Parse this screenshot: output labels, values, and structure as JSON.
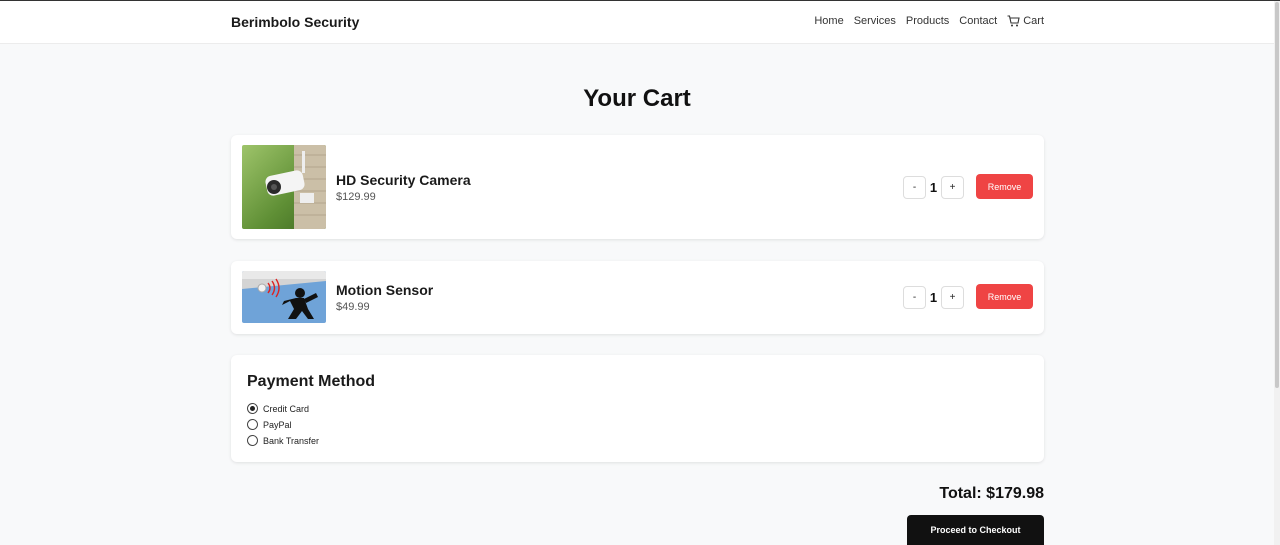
{
  "brand": "Berimbolo Security",
  "nav": {
    "home": "Home",
    "services": "Services",
    "products": "Products",
    "contact": "Contact",
    "cart": "Cart"
  },
  "page_title": "Your Cart",
  "items": [
    {
      "name": "HD Security Camera",
      "price": "$129.99",
      "qty": "1",
      "minus": "-",
      "plus": "+",
      "remove": "Remove"
    },
    {
      "name": "Motion Sensor",
      "price": "$49.99",
      "qty": "1",
      "minus": "-",
      "plus": "+",
      "remove": "Remove"
    }
  ],
  "payment": {
    "title": "Payment Method",
    "options": [
      "Credit Card",
      "PayPal",
      "Bank Transfer"
    ],
    "selected": "Credit Card"
  },
  "total": "Total: $179.98",
  "checkout_label": "Proceed to Checkout",
  "colors": {
    "remove": "#ef4444",
    "checkout": "#111111",
    "background": "#f8f9fa"
  }
}
